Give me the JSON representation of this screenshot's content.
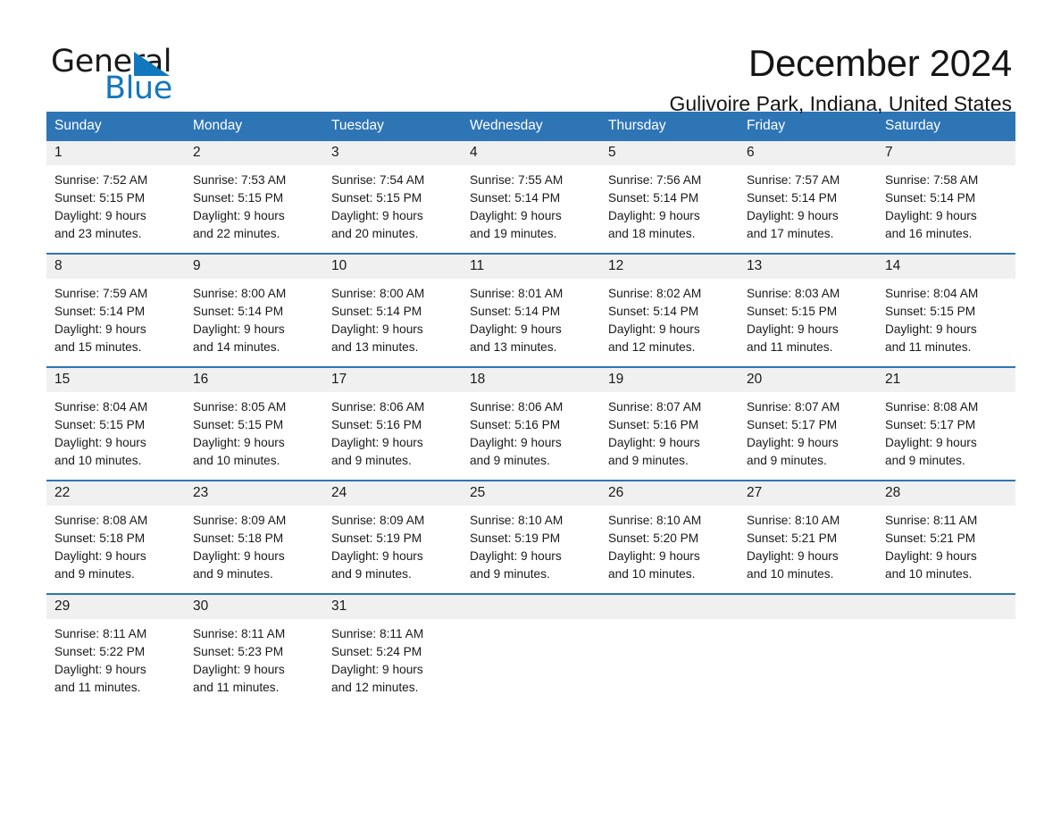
{
  "logo": {
    "word_one": "General",
    "word_two": "Blue",
    "triangle": "triangle-mark",
    "accent_color": "#1278be"
  },
  "header": {
    "title": "December 2024",
    "location": "Gulivoire Park, Indiana, United States"
  },
  "theme": {
    "header_blue": "#2e75b6",
    "daynum_gray": "#f0f0f0",
    "text": "#1a1a1a"
  },
  "calendar": {
    "weekdays": [
      "Sunday",
      "Monday",
      "Tuesday",
      "Wednesday",
      "Thursday",
      "Friday",
      "Saturday"
    ],
    "weeks": [
      [
        {
          "day": "1",
          "sunrise": "Sunrise: 7:52 AM",
          "sunset": "Sunset: 5:15 PM",
          "daylight_1": "Daylight: 9 hours",
          "daylight_2": "and 23 minutes."
        },
        {
          "day": "2",
          "sunrise": "Sunrise: 7:53 AM",
          "sunset": "Sunset: 5:15 PM",
          "daylight_1": "Daylight: 9 hours",
          "daylight_2": "and 22 minutes."
        },
        {
          "day": "3",
          "sunrise": "Sunrise: 7:54 AM",
          "sunset": "Sunset: 5:15 PM",
          "daylight_1": "Daylight: 9 hours",
          "daylight_2": "and 20 minutes."
        },
        {
          "day": "4",
          "sunrise": "Sunrise: 7:55 AM",
          "sunset": "Sunset: 5:14 PM",
          "daylight_1": "Daylight: 9 hours",
          "daylight_2": "and 19 minutes."
        },
        {
          "day": "5",
          "sunrise": "Sunrise: 7:56 AM",
          "sunset": "Sunset: 5:14 PM",
          "daylight_1": "Daylight: 9 hours",
          "daylight_2": "and 18 minutes."
        },
        {
          "day": "6",
          "sunrise": "Sunrise: 7:57 AM",
          "sunset": "Sunset: 5:14 PM",
          "daylight_1": "Daylight: 9 hours",
          "daylight_2": "and 17 minutes."
        },
        {
          "day": "7",
          "sunrise": "Sunrise: 7:58 AM",
          "sunset": "Sunset: 5:14 PM",
          "daylight_1": "Daylight: 9 hours",
          "daylight_2": "and 16 minutes."
        }
      ],
      [
        {
          "day": "8",
          "sunrise": "Sunrise: 7:59 AM",
          "sunset": "Sunset: 5:14 PM",
          "daylight_1": "Daylight: 9 hours",
          "daylight_2": "and 15 minutes."
        },
        {
          "day": "9",
          "sunrise": "Sunrise: 8:00 AM",
          "sunset": "Sunset: 5:14 PM",
          "daylight_1": "Daylight: 9 hours",
          "daylight_2": "and 14 minutes."
        },
        {
          "day": "10",
          "sunrise": "Sunrise: 8:00 AM",
          "sunset": "Sunset: 5:14 PM",
          "daylight_1": "Daylight: 9 hours",
          "daylight_2": "and 13 minutes."
        },
        {
          "day": "11",
          "sunrise": "Sunrise: 8:01 AM",
          "sunset": "Sunset: 5:14 PM",
          "daylight_1": "Daylight: 9 hours",
          "daylight_2": "and 13 minutes."
        },
        {
          "day": "12",
          "sunrise": "Sunrise: 8:02 AM",
          "sunset": "Sunset: 5:14 PM",
          "daylight_1": "Daylight: 9 hours",
          "daylight_2": "and 12 minutes."
        },
        {
          "day": "13",
          "sunrise": "Sunrise: 8:03 AM",
          "sunset": "Sunset: 5:15 PM",
          "daylight_1": "Daylight: 9 hours",
          "daylight_2": "and 11 minutes."
        },
        {
          "day": "14",
          "sunrise": "Sunrise: 8:04 AM",
          "sunset": "Sunset: 5:15 PM",
          "daylight_1": "Daylight: 9 hours",
          "daylight_2": "and 11 minutes."
        }
      ],
      [
        {
          "day": "15",
          "sunrise": "Sunrise: 8:04 AM",
          "sunset": "Sunset: 5:15 PM",
          "daylight_1": "Daylight: 9 hours",
          "daylight_2": "and 10 minutes."
        },
        {
          "day": "16",
          "sunrise": "Sunrise: 8:05 AM",
          "sunset": "Sunset: 5:15 PM",
          "daylight_1": "Daylight: 9 hours",
          "daylight_2": "and 10 minutes."
        },
        {
          "day": "17",
          "sunrise": "Sunrise: 8:06 AM",
          "sunset": "Sunset: 5:16 PM",
          "daylight_1": "Daylight: 9 hours",
          "daylight_2": "and 9 minutes."
        },
        {
          "day": "18",
          "sunrise": "Sunrise: 8:06 AM",
          "sunset": "Sunset: 5:16 PM",
          "daylight_1": "Daylight: 9 hours",
          "daylight_2": "and 9 minutes."
        },
        {
          "day": "19",
          "sunrise": "Sunrise: 8:07 AM",
          "sunset": "Sunset: 5:16 PM",
          "daylight_1": "Daylight: 9 hours",
          "daylight_2": "and 9 minutes."
        },
        {
          "day": "20",
          "sunrise": "Sunrise: 8:07 AM",
          "sunset": "Sunset: 5:17 PM",
          "daylight_1": "Daylight: 9 hours",
          "daylight_2": "and 9 minutes."
        },
        {
          "day": "21",
          "sunrise": "Sunrise: 8:08 AM",
          "sunset": "Sunset: 5:17 PM",
          "daylight_1": "Daylight: 9 hours",
          "daylight_2": "and 9 minutes."
        }
      ],
      [
        {
          "day": "22",
          "sunrise": "Sunrise: 8:08 AM",
          "sunset": "Sunset: 5:18 PM",
          "daylight_1": "Daylight: 9 hours",
          "daylight_2": "and 9 minutes."
        },
        {
          "day": "23",
          "sunrise": "Sunrise: 8:09 AM",
          "sunset": "Sunset: 5:18 PM",
          "daylight_1": "Daylight: 9 hours",
          "daylight_2": "and 9 minutes."
        },
        {
          "day": "24",
          "sunrise": "Sunrise: 8:09 AM",
          "sunset": "Sunset: 5:19 PM",
          "daylight_1": "Daylight: 9 hours",
          "daylight_2": "and 9 minutes."
        },
        {
          "day": "25",
          "sunrise": "Sunrise: 8:10 AM",
          "sunset": "Sunset: 5:19 PM",
          "daylight_1": "Daylight: 9 hours",
          "daylight_2": "and 9 minutes."
        },
        {
          "day": "26",
          "sunrise": "Sunrise: 8:10 AM",
          "sunset": "Sunset: 5:20 PM",
          "daylight_1": "Daylight: 9 hours",
          "daylight_2": "and 10 minutes."
        },
        {
          "day": "27",
          "sunrise": "Sunrise: 8:10 AM",
          "sunset": "Sunset: 5:21 PM",
          "daylight_1": "Daylight: 9 hours",
          "daylight_2": "and 10 minutes."
        },
        {
          "day": "28",
          "sunrise": "Sunrise: 8:11 AM",
          "sunset": "Sunset: 5:21 PM",
          "daylight_1": "Daylight: 9 hours",
          "daylight_2": "and 10 minutes."
        }
      ],
      [
        {
          "day": "29",
          "sunrise": "Sunrise: 8:11 AM",
          "sunset": "Sunset: 5:22 PM",
          "daylight_1": "Daylight: 9 hours",
          "daylight_2": "and 11 minutes."
        },
        {
          "day": "30",
          "sunrise": "Sunrise: 8:11 AM",
          "sunset": "Sunset: 5:23 PM",
          "daylight_1": "Daylight: 9 hours",
          "daylight_2": "and 11 minutes."
        },
        {
          "day": "31",
          "sunrise": "Sunrise: 8:11 AM",
          "sunset": "Sunset: 5:24 PM",
          "daylight_1": "Daylight: 9 hours",
          "daylight_2": "and 12 minutes."
        },
        {
          "day": "",
          "sunrise": "",
          "sunset": "",
          "daylight_1": "",
          "daylight_2": ""
        },
        {
          "day": "",
          "sunrise": "",
          "sunset": "",
          "daylight_1": "",
          "daylight_2": ""
        },
        {
          "day": "",
          "sunrise": "",
          "sunset": "",
          "daylight_1": "",
          "daylight_2": ""
        },
        {
          "day": "",
          "sunrise": "",
          "sunset": "",
          "daylight_1": "",
          "daylight_2": ""
        }
      ]
    ]
  }
}
